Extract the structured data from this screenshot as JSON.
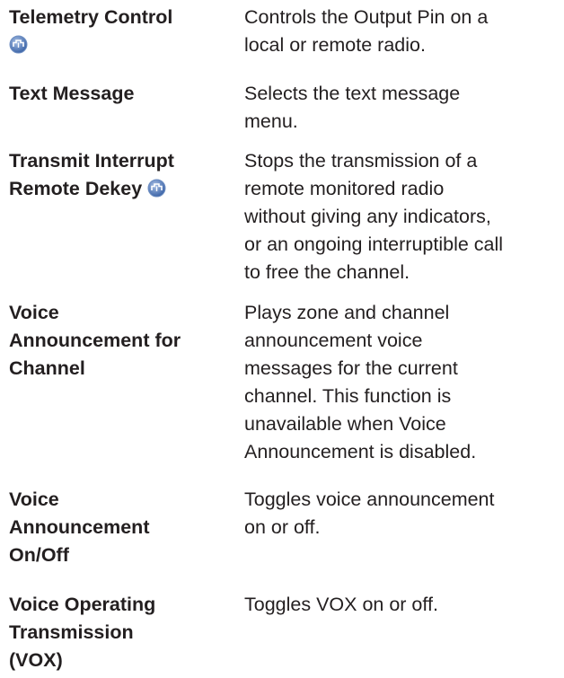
{
  "entries": [
    {
      "term_lines": [
        "Telemetry Control"
      ],
      "term_has_icon": true,
      "icon": "remote-capable-icon",
      "desc_lines": [
        "Controls the Output Pin on a",
        "local or remote radio."
      ]
    },
    {
      "term_lines": [
        "Text Message"
      ],
      "term_has_icon": false,
      "desc_lines": [
        "Selects the text message",
        "menu."
      ]
    },
    {
      "term_lines": [
        "Transmit Interrupt",
        "Remote Dekey"
      ],
      "term_has_icon": true,
      "icon": "remote-capable-icon",
      "desc_lines": [
        "Stops the transmission of a",
        "remote monitored radio",
        "without giving any indicators,",
        "or an ongoing interruptible call",
        "to free the channel."
      ]
    },
    {
      "term_lines": [
        "Voice",
        "Announcement for",
        "Channel"
      ],
      "term_has_icon": false,
      "desc_lines": [
        "Plays zone and channel",
        "announcement voice",
        "messages for the current",
        "channel. This function is",
        "unavailable when Voice",
        "Announcement is disabled."
      ]
    },
    {
      "term_lines": [
        "Voice",
        "Announcement",
        "On/Off"
      ],
      "term_has_icon": false,
      "desc_lines": [
        "Toggles voice announcement",
        "on or off."
      ]
    },
    {
      "term_lines": [
        "Voice Operating",
        "Transmission",
        "(VOX)"
      ],
      "term_has_icon": false,
      "desc_lines": [
        "Toggles VOX on or off."
      ]
    }
  ],
  "colors": {
    "text": "#231f20",
    "icon_fill": "#4f78b8",
    "icon_light": "#a9c1e6"
  }
}
